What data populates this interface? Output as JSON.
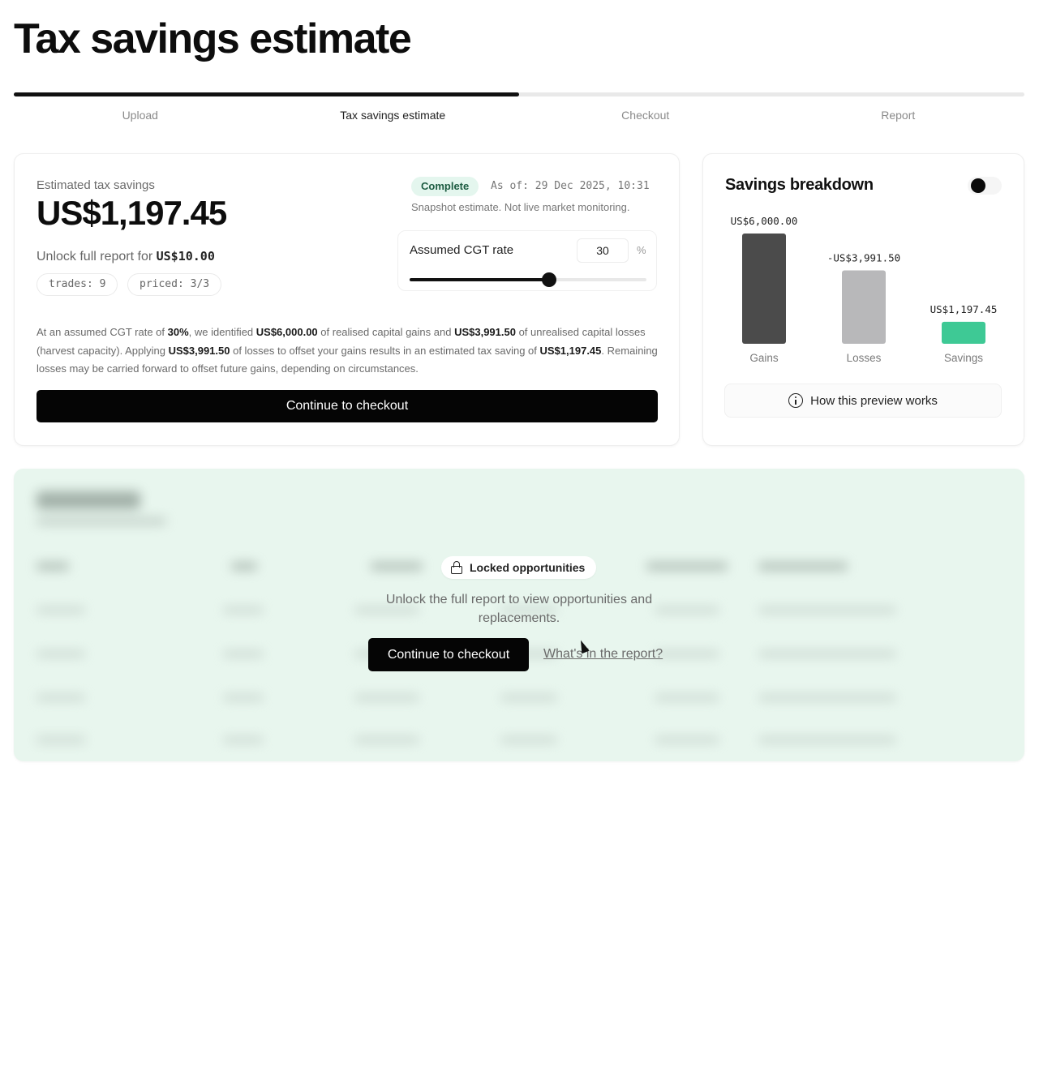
{
  "page": {
    "title": "Tax savings estimate"
  },
  "progress": {
    "fraction": 0.5,
    "steps": [
      {
        "label": "Upload",
        "active": false
      },
      {
        "label": "Tax savings estimate",
        "active": true
      },
      {
        "label": "Checkout",
        "active": false
      },
      {
        "label": "Report",
        "active": false
      }
    ]
  },
  "estimate": {
    "label": "Estimated tax savings",
    "value": "US$1,197.45",
    "unlock_prefix": "Unlock full report for",
    "unlock_price": "US$10.00",
    "pills": {
      "trades": "trades: 9",
      "priced": "priced: 3/3"
    },
    "status": "Complete",
    "as_of": "As of: 29 Dec 2025, 10:31",
    "snapshot_note": "Snapshot estimate. Not live market monitoring."
  },
  "rate": {
    "label": "Assumed CGT rate",
    "value": "30",
    "unit": "%",
    "slider_fraction": 0.59
  },
  "explanation": {
    "t1": "At an assumed CGT rate of ",
    "b1": "30%",
    "t2": ", we identified ",
    "b2": "US$6,000.00",
    "t3": " of realised capital gains and ",
    "b3": "US$3,991.50",
    "t4": " of unrealised capital losses (harvest capacity). Applying ",
    "b4": "US$3,991.50",
    "t5": " of losses to offset your gains results in an estimated tax saving of ",
    "b5": "US$1,197.45",
    "t6": ". Remaining losses may be carried forward to offset future gains, depending on circumstances."
  },
  "checkout_label": "Continue to checkout",
  "breakdown": {
    "title": "Savings breakdown",
    "toggle_on": true,
    "preview_label": "How this preview works",
    "info_icon": "info-icon"
  },
  "chart_data": {
    "type": "bar",
    "categories": [
      "Gains",
      "Losses",
      "Savings"
    ],
    "values": [
      6000.0,
      -3991.5,
      1197.45
    ],
    "labels": [
      "US$6,000.00",
      "-US$3,991.50",
      "US$1,197.45"
    ],
    "colors": [
      "#4b4b4b",
      "#b8b8ba",
      "#3ec995"
    ],
    "ylim": [
      0,
      6000
    ],
    "grid": false,
    "legend": "none"
  },
  "locked": {
    "pill_label": "Locked opportunities",
    "message": "Unlock the full report to view opportunities and replacements.",
    "button_label": "Continue to checkout",
    "link_label": "What's in the report?"
  }
}
